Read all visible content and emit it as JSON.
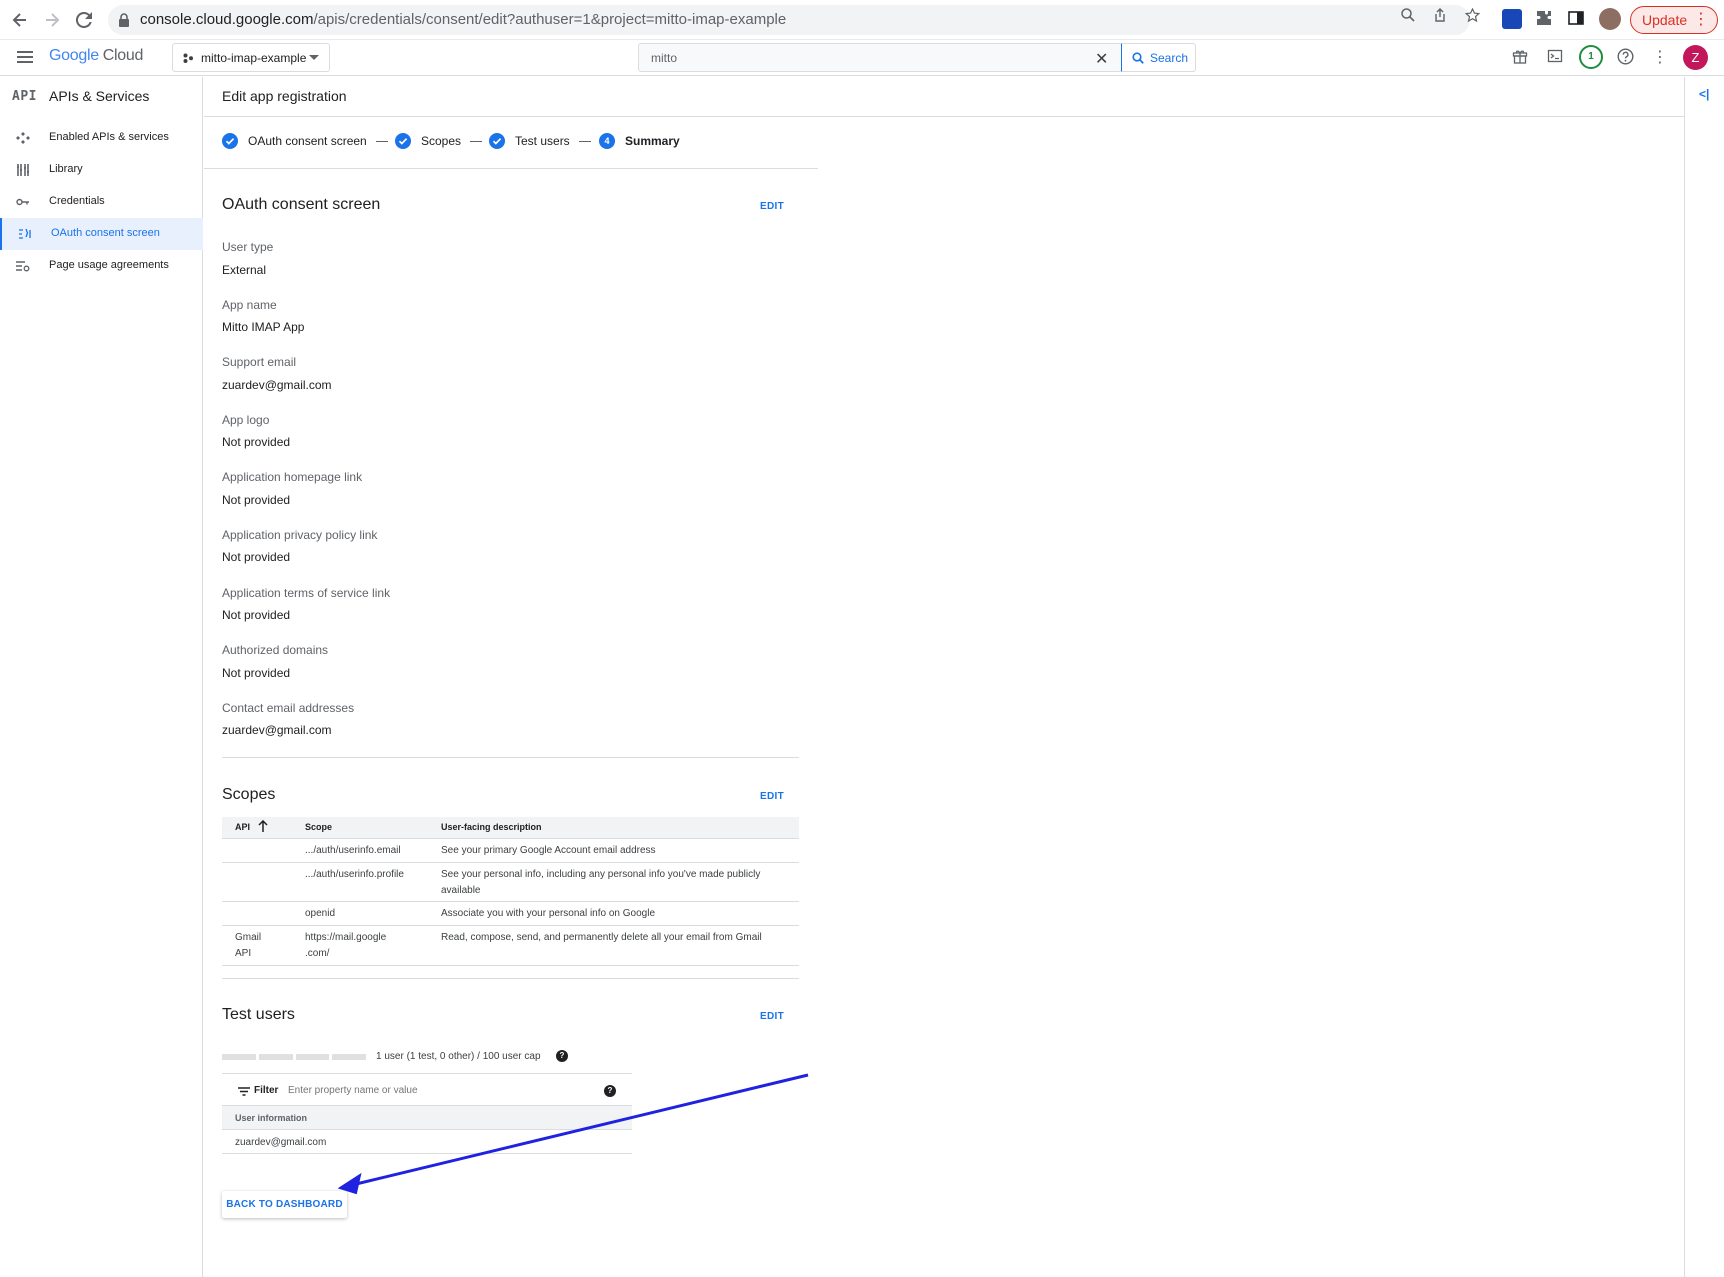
{
  "browser": {
    "url_host": "console.cloud.google.com",
    "url_path": "/apis/credentials/consent/edit?authuser=1&project=mitto-imap-example",
    "update_label": "Update"
  },
  "header": {
    "logo_text": "Google",
    "logo_suffix": "Cloud",
    "project_name": "mitto-imap-example",
    "search_value": "mitto",
    "search_button": "Search",
    "notification_count": "1",
    "avatar_letter": "Z"
  },
  "sidebar": {
    "product_mark": "API",
    "product_name": "APIs & Services",
    "items": [
      {
        "label": "Enabled APIs & services",
        "icon": "enabled-apis-icon"
      },
      {
        "label": "Library",
        "icon": "library-icon"
      },
      {
        "label": "Credentials",
        "icon": "key-icon"
      },
      {
        "label": "OAuth consent screen",
        "icon": "consent-icon",
        "active": true
      },
      {
        "label": "Page usage agreements",
        "icon": "settings-list-icon"
      }
    ]
  },
  "page": {
    "title": "Edit app registration"
  },
  "stepper": {
    "steps": [
      {
        "label": "OAuth consent screen",
        "state": "done"
      },
      {
        "label": "Scopes",
        "state": "done"
      },
      {
        "label": "Test users",
        "state": "done"
      },
      {
        "label": "Summary",
        "state": "current",
        "number": "4"
      }
    ]
  },
  "consent": {
    "title": "OAuth consent screen",
    "edit": "EDIT",
    "fields": [
      {
        "label": "User type",
        "value": "External"
      },
      {
        "label": "App name",
        "value": "Mitto IMAP App"
      },
      {
        "label": "Support email",
        "value": "zuardev@gmail.com"
      },
      {
        "label": "App logo",
        "value": "Not provided"
      },
      {
        "label": "Application homepage link",
        "value": "Not provided"
      },
      {
        "label": "Application privacy policy link",
        "value": "Not provided"
      },
      {
        "label": "Application terms of service link",
        "value": "Not provided"
      },
      {
        "label": "Authorized domains",
        "value": "Not provided"
      },
      {
        "label": "Contact email addresses",
        "value": "zuardev@gmail.com"
      }
    ]
  },
  "scopes": {
    "title": "Scopes",
    "edit": "EDIT",
    "columns": {
      "api": "API",
      "scope": "Scope",
      "description": "User-facing description"
    },
    "rows": [
      {
        "api": "",
        "scope": ".../auth/userinfo.email",
        "scope2": "",
        "description": "See your primary Google Account email address",
        "description2": ""
      },
      {
        "api": "",
        "scope": ".../auth/userinfo.profile",
        "scope2": "",
        "description": "See your personal info, including any personal info you've made publicly",
        "description2": "available"
      },
      {
        "api": "",
        "scope": "openid",
        "scope2": "",
        "description": "Associate you with your personal info on Google",
        "description2": ""
      },
      {
        "api": "Gmail",
        "api2": "API",
        "scope": "https://mail.google",
        "scope2": ".com/",
        "description": "Read, compose, send, and permanently delete all your email from Gmail",
        "description2": ""
      }
    ]
  },
  "test_users": {
    "title": "Test users",
    "edit": "EDIT",
    "cap_text": "1 user (1 test, 0 other) / 100 user cap",
    "cap_fraction": 0.01,
    "filter_label": "Filter",
    "filter_placeholder": "Enter property name or value",
    "column_user": "User information",
    "users": [
      "zuardev@gmail.com"
    ]
  },
  "actions": {
    "back": "BACK TO DASHBOARD"
  },
  "colors": {
    "accent": "#1a73e8",
    "annotation_arrow": "#1f22e0",
    "update": "#d93025"
  }
}
